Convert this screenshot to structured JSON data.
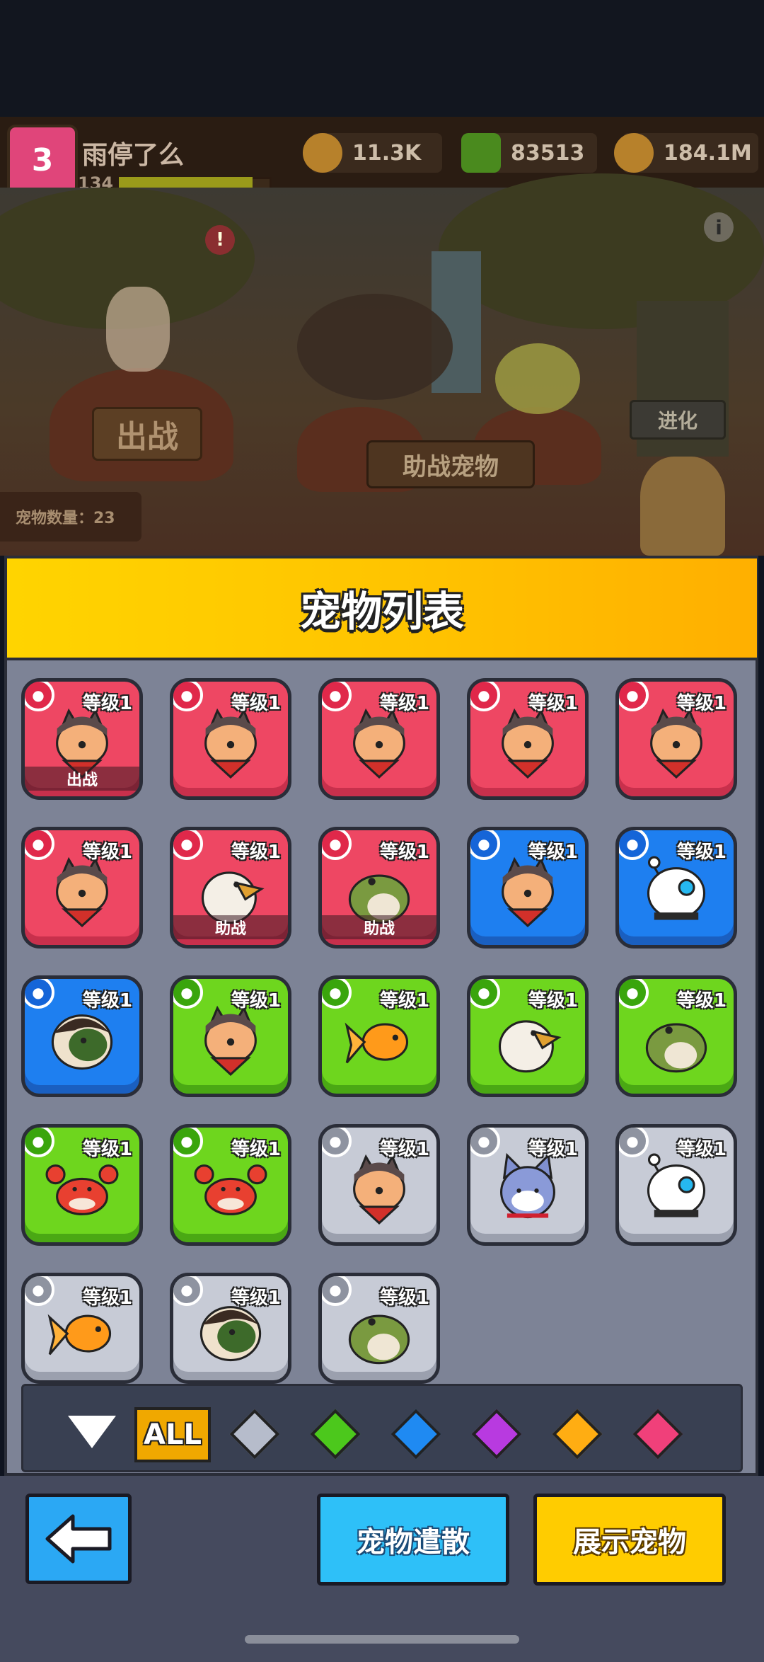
{
  "player": {
    "name": "雨停了么",
    "level": "134",
    "avatar_level": "3",
    "xp_fraction": 0.9
  },
  "resources": [
    {
      "icon": "gold-coin-icon",
      "value": "11.3K",
      "color": "#b7812b"
    },
    {
      "icon": "green-gem-icon",
      "value": "83513",
      "color": "#4a8a1e"
    },
    {
      "icon": "gold-stack-icon",
      "value": "184.1M",
      "color": "#b7812b"
    }
  ],
  "scene": {
    "deploy_label": "出战",
    "assist_label": "助战宠物",
    "evolve_label": "进化",
    "pet_count": "宠物数量：23"
  },
  "panel": {
    "title": "宠物列表"
  },
  "level_text": "等级1",
  "pets": [
    {
      "rarity": "red",
      "pet": "dog",
      "tag": "出战"
    },
    {
      "rarity": "red",
      "pet": "dog",
      "tag": ""
    },
    {
      "rarity": "red",
      "pet": "dog",
      "tag": ""
    },
    {
      "rarity": "red",
      "pet": "dog",
      "tag": ""
    },
    {
      "rarity": "red",
      "pet": "dog",
      "tag": ""
    },
    {
      "rarity": "red",
      "pet": "dog",
      "tag": ""
    },
    {
      "rarity": "red",
      "pet": "eagle",
      "tag": "助战"
    },
    {
      "rarity": "red",
      "pet": "frog",
      "tag": "助战"
    },
    {
      "rarity": "blue",
      "pet": "dog",
      "tag": ""
    },
    {
      "rarity": "blue",
      "pet": "robot",
      "tag": ""
    },
    {
      "rarity": "blue",
      "pet": "turtle",
      "tag": ""
    },
    {
      "rarity": "green",
      "pet": "dog",
      "tag": ""
    },
    {
      "rarity": "green",
      "pet": "goldfish",
      "tag": ""
    },
    {
      "rarity": "green",
      "pet": "eagle",
      "tag": ""
    },
    {
      "rarity": "green",
      "pet": "frog",
      "tag": ""
    },
    {
      "rarity": "green",
      "pet": "crab",
      "tag": ""
    },
    {
      "rarity": "green",
      "pet": "crab",
      "tag": ""
    },
    {
      "rarity": "gray",
      "pet": "dog",
      "tag": ""
    },
    {
      "rarity": "gray",
      "pet": "cat",
      "tag": ""
    },
    {
      "rarity": "gray",
      "pet": "robot",
      "tag": ""
    },
    {
      "rarity": "gray",
      "pet": "goldfish",
      "tag": ""
    },
    {
      "rarity": "gray",
      "pet": "turtle",
      "tag": ""
    },
    {
      "rarity": "gray",
      "pet": "frog",
      "tag": ""
    }
  ],
  "filters": {
    "all_label": "ALL",
    "gems": [
      {
        "name": "gray",
        "color": "#b6bccb"
      },
      {
        "name": "green",
        "color": "#4cc81c"
      },
      {
        "name": "blue",
        "color": "#1f8af2"
      },
      {
        "name": "purple",
        "color": "#b83ae0"
      },
      {
        "name": "orange",
        "color": "#ffad12"
      },
      {
        "name": "pink",
        "color": "#f0407a"
      }
    ]
  },
  "bottom": {
    "dismiss_label": "宠物遣散",
    "show_label": "展示宠物"
  }
}
